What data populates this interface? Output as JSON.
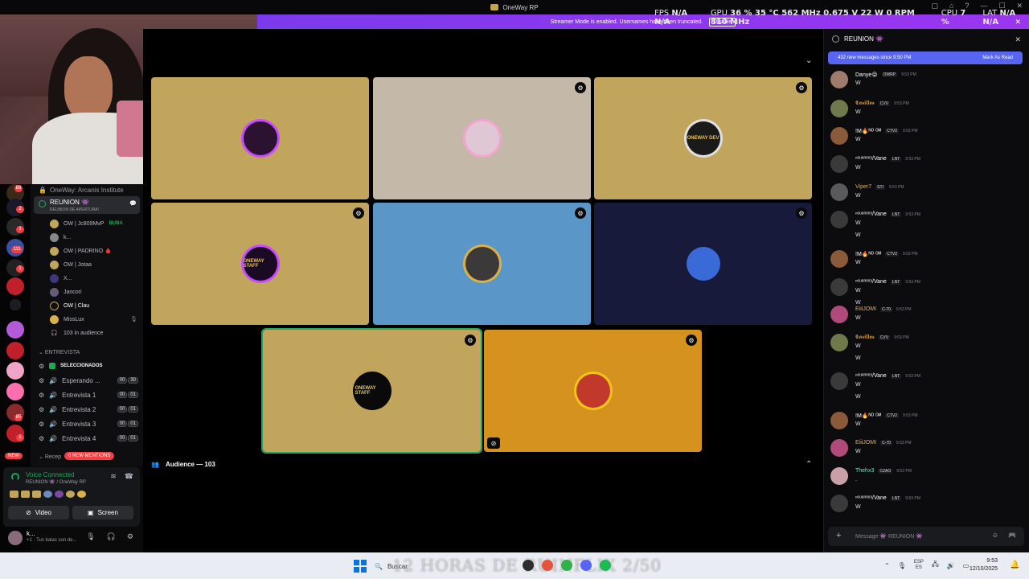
{
  "window": {
    "title": "OneWay RP",
    "controls": [
      "▢",
      "⌂",
      "?",
      "—",
      "☐",
      "✕"
    ]
  },
  "stats": {
    "fps_label": "FPS",
    "fps": "N/A N/A",
    "gpu_label": "GPU",
    "gpu": "36 %  35 °C  562 MHz  0.675 V  22 W  0 RPM  810 MHz",
    "cpu_label": "CPU",
    "cpu": "7 %",
    "lat_label": "LAT",
    "lat": "N/A N/A"
  },
  "streamer_bar": {
    "text": "Streamer Mode is enabled. Usernames have been truncated.",
    "button": "Disable"
  },
  "rail": {
    "badges": [
      "88",
      "2",
      "1",
      "111",
      "1",
      "1",
      "85",
      "1"
    ],
    "new_label": "NEW"
  },
  "channel_list": {
    "server_header": "OneWay: Arcanis Institute",
    "active_channel": {
      "name": "REUNION 👾",
      "topic": "REUNION DE APERTURA!"
    },
    "members": [
      {
        "name": "OW | Jc809MvP",
        "tag": "BUBA"
      },
      {
        "name": "k...",
        "tag": ""
      },
      {
        "name": "OW | PADRINO 🩸",
        "tag": ""
      },
      {
        "name": "OW | Jotaa",
        "tag": ""
      },
      {
        "name": "X...",
        "tag": ""
      },
      {
        "name": "Jancori",
        "tag": ""
      },
      {
        "name": "OW | Clau",
        "tag": ""
      },
      {
        "name": "MissLux",
        "tag": ""
      }
    ],
    "audience_count": "103 in audience",
    "category_entrevista": "ENTREVISTA",
    "seleccionados": "SELECCIONADOS",
    "voice_channels": [
      {
        "name": "Esperando ...",
        "a": "00",
        "b": "30"
      },
      {
        "name": "Entrevista 1",
        "a": "00",
        "b": "01"
      },
      {
        "name": "Entrevista 2",
        "a": "00",
        "b": "01"
      },
      {
        "name": "Entrevista 3",
        "a": "00",
        "b": "01"
      },
      {
        "name": "Entrevista 4",
        "a": "00",
        "b": "01"
      }
    ],
    "recep_label": "Recep",
    "mentions_pill": "6 NEW MENTIONS"
  },
  "voice_panel": {
    "status": "Voice Connected",
    "location": "REUNION 👾 / OneWay RP",
    "video_label": "Video",
    "screen_label": "Screen"
  },
  "user": {
    "name": "k...",
    "status": "+1 · Tus balas son de..."
  },
  "stage": {
    "tiles": [
      {
        "color": "#c2a55c",
        "avatar": "#2a1230",
        "ring": "#c84bff",
        "label": "",
        "gear": false
      },
      {
        "color": "#c4b8a8",
        "avatar": "#e0c7d6",
        "ring": "#f3a5d0",
        "label": "",
        "gear": true
      },
      {
        "color": "#c2a55c",
        "avatar": "#1a1a1a",
        "ring": "#e0e0e0",
        "label": "ONEWAY DEV",
        "gear": true
      },
      {
        "color": "#c2a55c",
        "avatar": "#1a0a24",
        "ring": "#c84bff",
        "label": "ONEWAY STAFF",
        "gear": true
      },
      {
        "color": "#5b96c9",
        "avatar": "#3b3a38",
        "ring": "#d9b14a",
        "label": "",
        "gear": true
      },
      {
        "color": "#171a3a",
        "avatar": "#3a6ad8",
        "ring": "#171a3a",
        "label": "",
        "gear": true
      },
      {
        "color": "#c2a55c",
        "avatar": "#0a0a0a",
        "ring": "#0a0a0a",
        "label": "ONEWAY STAFF",
        "gear": true
      },
      {
        "color": "#d6921f",
        "avatar": "#c0392b",
        "ring": "#f0c419",
        "label": "",
        "gear": true
      }
    ],
    "audience_label": "Audience — 103"
  },
  "chat": {
    "title": "REUNION 👾",
    "new_messages": "432 new messages since 9:50 PM",
    "mark_read": "Mark As Read",
    "messages": [
      {
        "name": "Danye😝",
        "role": "OWRP",
        "time": "9:53 PM",
        "text": "W",
        "text2": "",
        "color": "#ffffff",
        "av": "#9e7b6b"
      },
      {
        "name": "𝕮𝖆𝖘𝖎𝖑𝖑𝖆𝖘",
        "role": "CVV",
        "time": "9:53 PM",
        "text": "W",
        "text2": "",
        "color": "#e8b04a",
        "av": "#6f7a4a"
      },
      {
        "name": "!M🔥ᴺᴼ ᴼᴹ",
        "role": "CTV2",
        "time": "9:53 PM",
        "text": "W",
        "text2": "",
        "color": "#ffffff",
        "av": "#8a5a3a"
      },
      {
        "name": "ⁿᵒᵘᵉᵐᵒʳʸ/Vane",
        "role": "LNT",
        "time": "9:53 PM",
        "text": "W",
        "text2": "",
        "color": "#ffffff",
        "av": "#3a3a3a"
      },
      {
        "name": "Viper7",
        "role": "STI",
        "time": "9:53 PM",
        "text": "W",
        "text2": "",
        "color": "#e8b04a",
        "av": "#5a5a5a"
      },
      {
        "name": "ⁿᵒᵘᵉᵐᵒʳʸ/Vane",
        "role": "LNT",
        "time": "9:53 PM",
        "text": "W",
        "text2": "W",
        "color": "#ffffff",
        "av": "#3a3a3a"
      },
      {
        "name": "!M🔥ᴺᴼ ᴼᴹ",
        "role": "CTV2",
        "time": "9:53 PM",
        "text": "W",
        "text2": "",
        "color": "#ffffff",
        "av": "#8a5a3a"
      },
      {
        "name": "ⁿᵒᵘᵉᵐᵒʳʸ/Vane",
        "role": "LNT",
        "time": "9:53 PM",
        "text": "W",
        "text2": "W",
        "color": "#ffffff",
        "av": "#3a3a3a"
      },
      {
        "name": "EiiiJOMI",
        "role": "C-70",
        "time": "9:53 PM",
        "text": "W",
        "text2": "",
        "color": "#e8b04a",
        "av": "#b04a7a"
      },
      {
        "name": "𝕮𝖆𝖘𝖎𝖑𝖑𝖆𝖘",
        "role": "CVV",
        "time": "9:53 PM",
        "text": "W",
        "text2": "W",
        "color": "#e8b04a",
        "av": "#6f7a4a"
      },
      {
        "name": "ⁿᵒᵘᵉᵐᵒʳʸ/Vane",
        "role": "LNT",
        "time": "9:53 PM",
        "text": "W",
        "text2": "W",
        "color": "#ffffff",
        "av": "#3a3a3a"
      },
      {
        "name": "!M🔥ᴺᴼ ᴼᴹ",
        "role": "CTV2",
        "time": "9:53 PM",
        "text": "W",
        "text2": "",
        "color": "#ffffff",
        "av": "#8a5a3a"
      },
      {
        "name": "EiiiJOMI",
        "role": "C-70",
        "time": "9:53 PM",
        "text": "W",
        "text2": "",
        "color": "#e8b04a",
        "av": "#b04a7a"
      },
      {
        "name": "Thehx3",
        "role": "CZAO",
        "time": "9:53 PM",
        "text": ".",
        "text2": "",
        "color": "#7ee0c0",
        "av": "#c9a0a8"
      },
      {
        "name": "ⁿᵒᵘᵉᵐᵒʳʸ/Vane",
        "role": "LNT",
        "time": "9:53 PM",
        "text": "W",
        "text2": "",
        "color": "#ffffff",
        "av": "#3a3a3a"
      }
    ],
    "input_placeholder": "Message 👾 REUNION 👾"
  },
  "taskbar": {
    "search_text": "Buscar",
    "overlay_title": "12 HORAS DE RUINFLIX 2/50",
    "lang_top": "ESP",
    "lang_bottom": "ES",
    "time": "9:53",
    "date": "12/10/2025",
    "app_colors": [
      "#2d2d2d",
      "#e5533d",
      "#30b14a",
      "#5865f2",
      "#1db954"
    ]
  }
}
